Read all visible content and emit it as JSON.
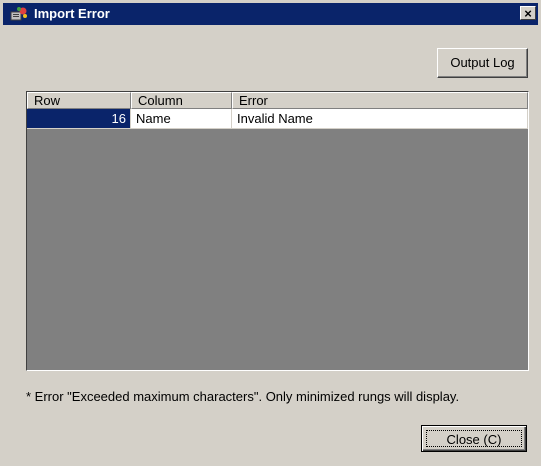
{
  "window": {
    "title": "Import Error",
    "close_glyph": "×",
    "icon": "import-error-icon"
  },
  "buttons": {
    "output_log": "Output Log",
    "close": "Close (C)"
  },
  "grid": {
    "columns": [
      "Row",
      "Column",
      "Error"
    ],
    "rows": [
      {
        "row": "16",
        "column": "Name",
        "error": "Invalid Name"
      }
    ]
  },
  "note": "* Error \"Exceeded maximum characters\". Only minimized rungs will display.",
  "colors": {
    "titlebar": "#0a246a",
    "face": "#d4d0c8",
    "grid_bg": "#808080",
    "selection": "#0a246a"
  }
}
